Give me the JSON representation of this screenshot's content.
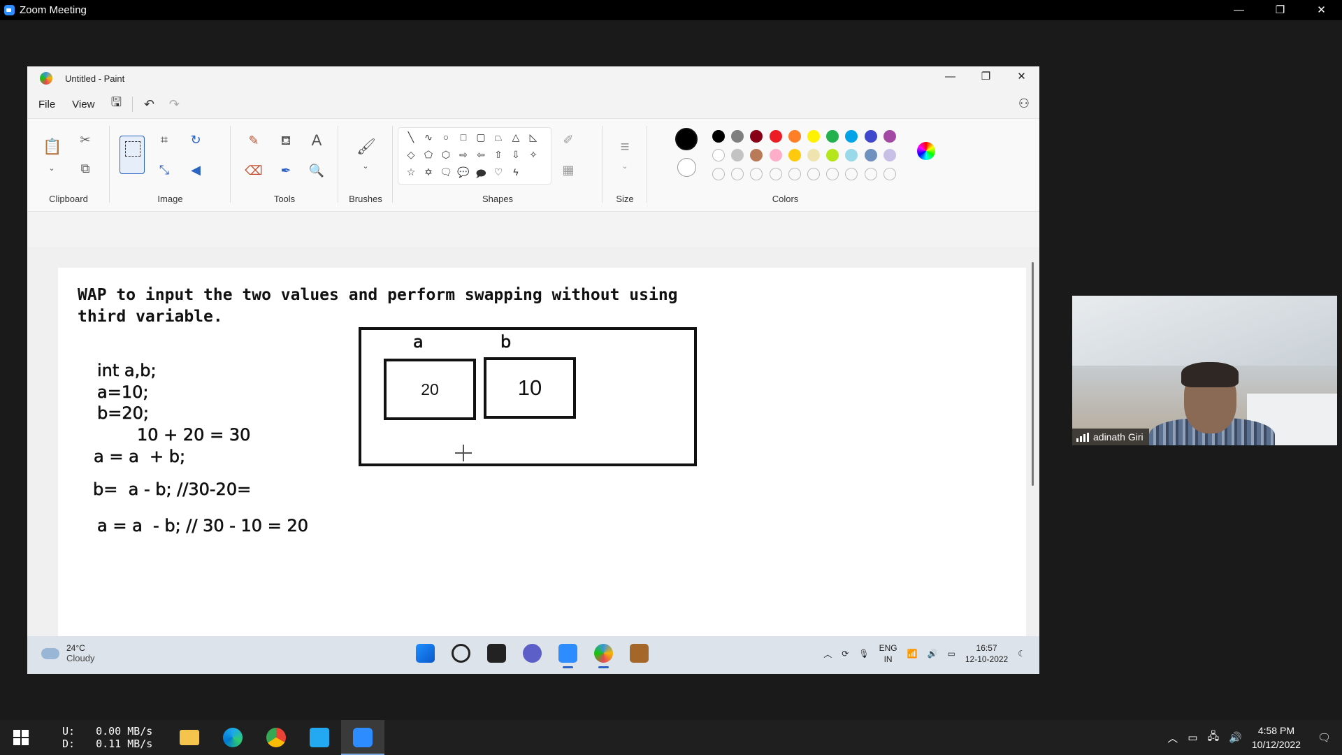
{
  "zoom": {
    "title": "Zoom Meeting",
    "controls": [
      "—",
      "❐",
      "✕"
    ]
  },
  "paint": {
    "title": "Untitled - Paint",
    "window_controls": [
      "—",
      "❐",
      "✕"
    ],
    "menu": {
      "file": "File",
      "view": "View"
    },
    "ribbon": {
      "clipboard": "Clipboard",
      "image": "Image",
      "tools": "Tools",
      "brushes": "Brushes",
      "shapes": "Shapes",
      "size": "Size",
      "colors": "Colors"
    },
    "palette": {
      "primary": "#000000",
      "secondary": "#ffffff",
      "row1": [
        "#000000",
        "#7f7f7f",
        "#880015",
        "#ed1c24",
        "#ff7f27",
        "#fff200",
        "#22b14c",
        "#00a2e8",
        "#3f48cc",
        "#a349a4"
      ],
      "row2": [
        "#ffffff",
        "#c3c3c3",
        "#b97a57",
        "#ffaec9",
        "#ffc90e",
        "#efe4b0",
        "#b5e61d",
        "#99d9ea",
        "#7092be",
        "#c8bfe7"
      ]
    },
    "canvas": {
      "heading_line1": "WAP to input the two values and perform swapping without using",
      "heading_line2": "third variable.",
      "code": [
        "int a,b;",
        "a=10;",
        "b=20;",
        "10 + 20 = 30",
        "a = a  + b;",
        "b=  a - b; //30-20=",
        "a = a  - b; // 30 - 10 = 20"
      ],
      "diagram": {
        "label_a": "a",
        "label_b": "b",
        "value_a": "20",
        "value_b": "10"
      }
    },
    "taskbar": {
      "temperature": "24°C",
      "weather": "Cloudy",
      "lang1": "ENG",
      "lang2": "IN",
      "time": "16:57",
      "date": "12-10-2022"
    }
  },
  "participant": {
    "name": "adinath Giri"
  },
  "host_taskbar": {
    "net_label_up": "U:",
    "net_label_down": "D:",
    "net_up": "0.00 MB/s",
    "net_down": "0.11 MB/s",
    "time": "4:58 PM",
    "date": "10/12/2022"
  }
}
